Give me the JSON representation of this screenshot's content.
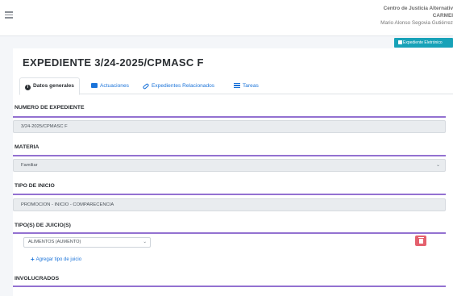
{
  "header": {
    "menu_icon": "hamburger-menu-icon",
    "org_line1": "Centro de Justicia Alternativ",
    "org_line2": "CARMEI",
    "org_line3": "Mario Alonso Segovia Gutiérrez"
  },
  "toolbar": {
    "expediente_button_label": "Expediente Eletrónico",
    "expediente_button_icon": "document-icon",
    "button_color": "#17a2b8"
  },
  "page": {
    "title": "EXPEDIENTE 3/24-2025/CPMASC F"
  },
  "tabs": [
    {
      "label": "Datos generales",
      "icon": "info-icon",
      "active": true
    },
    {
      "label": "Actuaciones",
      "icon": "folder-icon",
      "active": false
    },
    {
      "label": "Expedientes Relacionados",
      "icon": "link-icon",
      "active": false
    },
    {
      "label": "Tareas",
      "icon": "list-icon",
      "active": false
    }
  ],
  "form": {
    "numero": {
      "label": "NUMERO DE EXPEDIENTE",
      "value": "3/24-2025/CPMASC F"
    },
    "materia": {
      "label": "MATERIA",
      "value": "Familiar"
    },
    "tipo_inicio": {
      "label": "TIPO DE INICIO",
      "value": "PROMOCION - INICIO - COMPARECENCIA"
    },
    "tipo_juicio": {
      "label": "TIPO(S) DE JUICIO(S)",
      "value": "ALIMENTOS (AUMENTO)",
      "delete_icon": "trash-icon",
      "add_link": "Agregar tipo de juicio"
    },
    "involucrados": {
      "label": "INVOLUCRADOS"
    }
  },
  "colors": {
    "accent_rule": "#6f42c1",
    "link": "#1a73d9",
    "danger": "#e4606d"
  }
}
